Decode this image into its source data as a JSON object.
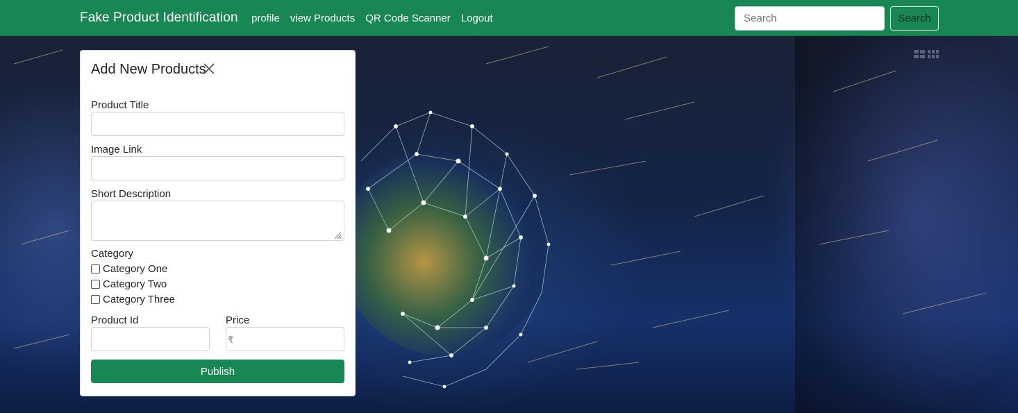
{
  "navbar": {
    "brand": "Fake Product Identification",
    "links": [
      "profile",
      "view Products",
      "QR Code Scanner",
      "Logout"
    ],
    "search_placeholder": "Search",
    "search_button": "Search"
  },
  "form": {
    "title": "Add New Products",
    "fields": {
      "product_title": {
        "label": "Product Title",
        "value": ""
      },
      "image_link": {
        "label": "Image Link",
        "value": ""
      },
      "short_description": {
        "label": "Short Description",
        "value": ""
      },
      "product_id": {
        "label": "Product Id",
        "value": ""
      },
      "price": {
        "label": "Price",
        "prefix": "₹",
        "value": ""
      }
    },
    "category": {
      "label": "Category",
      "options": [
        {
          "label": "Category One",
          "checked": false
        },
        {
          "label": "Category Two",
          "checked": false
        },
        {
          "label": "Category Three",
          "checked": false
        }
      ]
    },
    "submit_label": "Publish"
  },
  "icons": {
    "close": "close-icon",
    "grid": "grid-icon"
  },
  "colors": {
    "primary_green": "#198754",
    "card_bg": "#ffffff"
  }
}
